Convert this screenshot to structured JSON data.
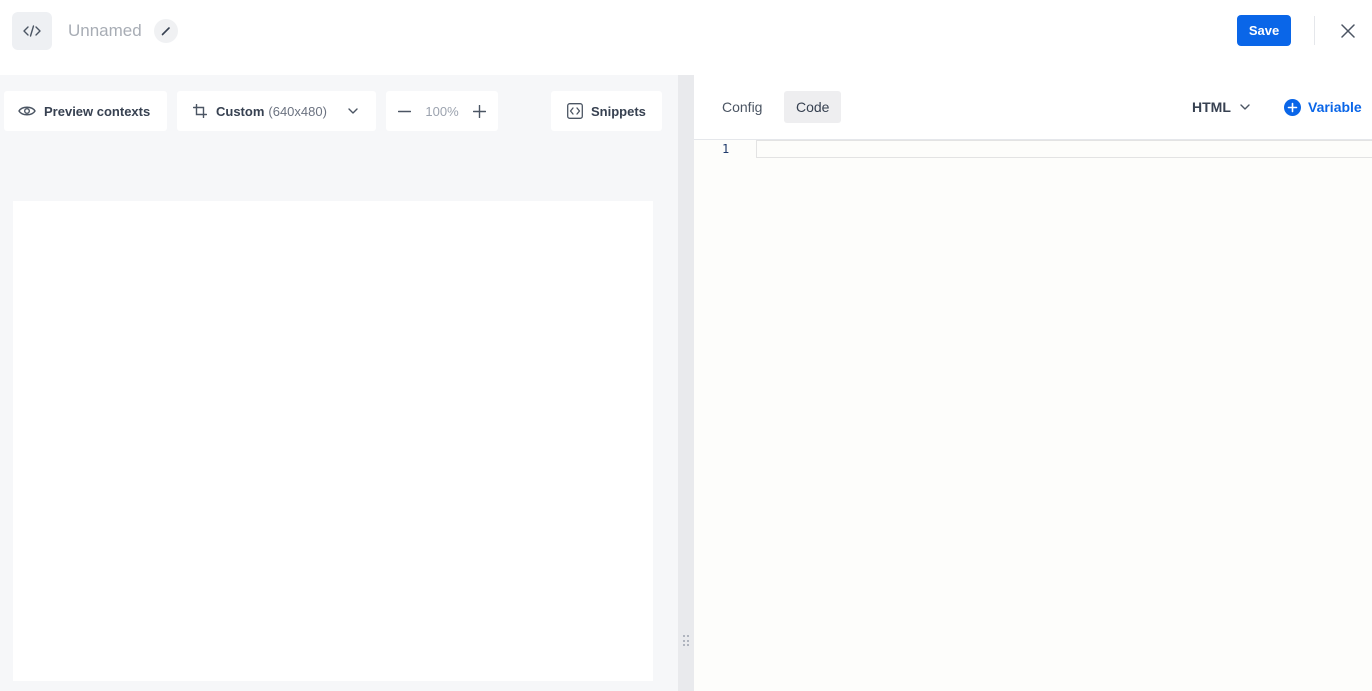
{
  "header": {
    "logo_icon": "code-brackets-icon",
    "title": "Unnamed",
    "edit_icon": "pencil-icon",
    "save_label": "Save",
    "close_icon": "close-icon"
  },
  "toolbar": {
    "preview_label": "Preview contexts",
    "preview_icon": "eye-icon",
    "size_label": "Custom",
    "size_dims": "(640x480)",
    "size_icon": "crop-icon",
    "zoom_value": "100%",
    "snippets_label": "Snippets",
    "snippets_icon": "code-box-icon"
  },
  "canvas": {
    "width": 640,
    "height": 480
  },
  "code_panel": {
    "tabs": [
      {
        "label": "Config",
        "active": false
      },
      {
        "label": "Code",
        "active": true
      }
    ],
    "language": "HTML",
    "add_variable_label": "Variable",
    "line_numbers": [
      "1"
    ]
  },
  "colors": {
    "primary": "#0a66e8",
    "preview_bg": "#f6f7f9",
    "editor_bg": "#fdfdfb"
  }
}
